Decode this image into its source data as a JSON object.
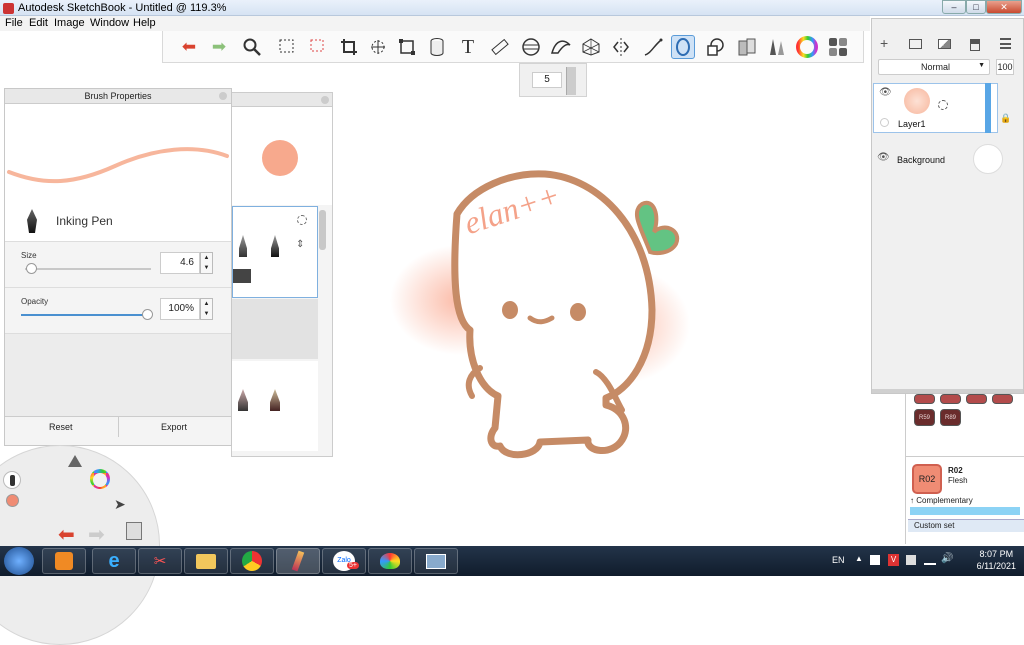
{
  "window": {
    "title": "Autodesk SketchBook - Untitled @ 119.3%",
    "min": "–",
    "max": "□",
    "close": "✕"
  },
  "menu": [
    "File",
    "Edit",
    "Image",
    "Window",
    "Help"
  ],
  "toolbar": {
    "tools": [
      "undo-icon",
      "redo-icon",
      "zoom-icon",
      "select-rect-icon",
      "select-lasso-icon",
      "crop-icon",
      "transform-icon",
      "distort-icon",
      "fill-icon",
      "text-icon",
      "ruler-icon",
      "ellipse-icon",
      "french-curve-icon",
      "perspective-icon",
      "symmetry-icon",
      "stroke-icon",
      "predictive-stroke-icon",
      "shape-icon",
      "copic-icon",
      "brush-icon",
      "color-wheel-icon",
      "palette-icon"
    ],
    "selected": "predictive-stroke-icon"
  },
  "brush_size_popup": {
    "value": "5"
  },
  "brush_properties": {
    "title": "Brush Properties",
    "brush_name": "Inking Pen",
    "size_label": "Size",
    "size_value": "4.6",
    "size_fraction": 0.05,
    "opacity_label": "Opacity",
    "opacity_value": "100%",
    "opacity_fraction": 1.0,
    "reset_label": "Reset",
    "export_label": "Export",
    "stroke_color": "#f7b69c"
  },
  "brush_library": {
    "preview_color": "#f7a98d"
  },
  "layers": {
    "blend_mode": "Normal",
    "opacity": "100",
    "items": [
      {
        "name": "Layer1",
        "visible": true
      },
      {
        "name": "Background",
        "visible": true
      }
    ]
  },
  "colors": {
    "swatches": [
      "R59",
      "R89"
    ],
    "current_code": "R02",
    "current_name": "Flesh",
    "current_color": "#f08c74",
    "complementary_label": "Complementary",
    "custom_set_label": "Custom set"
  },
  "taskbar": {
    "language": "EN",
    "time": "8:07 PM",
    "date": "6/11/2021",
    "zalo_badge": "5+",
    "zalo_label": "Zalo"
  },
  "canvas": {
    "drawing_text": "elan++"
  }
}
